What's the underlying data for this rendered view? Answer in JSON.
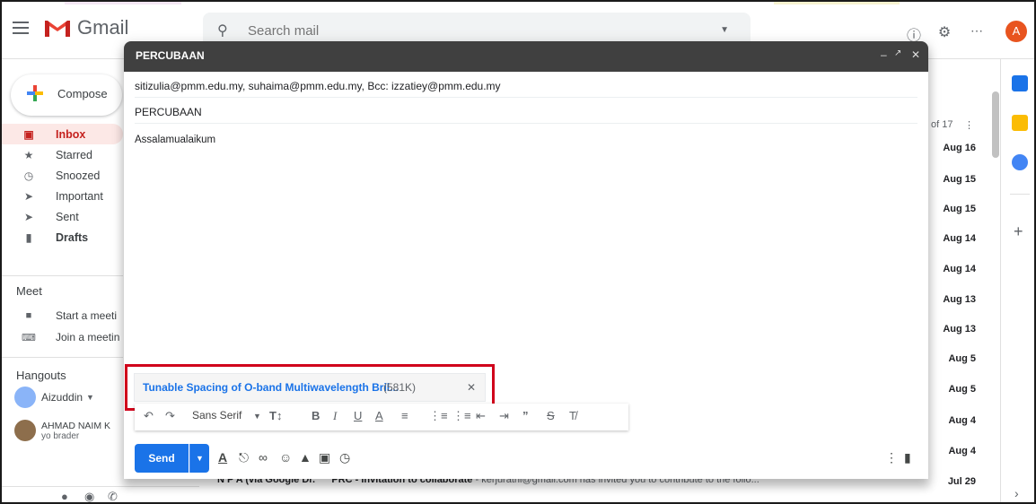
{
  "app": {
    "logo_text": "Gmail",
    "avatar_letter": "A"
  },
  "search": {
    "placeholder": "Search mail"
  },
  "sidebar": {
    "compose_label": "Compose",
    "items": [
      {
        "label": "Inbox",
        "icon": "inbox-icon"
      },
      {
        "label": "Starred",
        "icon": "star-icon"
      },
      {
        "label": "Snoozed",
        "icon": "clock-icon"
      },
      {
        "label": "Important",
        "icon": "important-icon"
      },
      {
        "label": "Sent",
        "icon": "send-icon"
      },
      {
        "label": "Drafts",
        "icon": "draft-icon"
      }
    ],
    "meet_title": "Meet",
    "meet_items": [
      "Start a meeti",
      "Join a meetin"
    ],
    "hangouts_title": "Hangouts",
    "hangouts_user": "Aizuddin",
    "hangouts_contact": "AHMAD NAIM K",
    "hangouts_contact_status": "yo brader"
  },
  "list": {
    "count": "of 17",
    "dates": [
      "Aug 16",
      "Aug 15",
      "Aug 15",
      "Aug 14",
      "Aug 14",
      "Aug 13",
      "Aug 13",
      "Aug 5",
      "Aug 5",
      "Aug 4",
      "Aug 4",
      "Jul 29"
    ],
    "behind_sender": "N P A (via Google Dr.",
    "behind_subject": "PRC - Invitation to collaborate",
    "behind_snippet": "- kerjurathi@gmail.com has invited you to contribute to the follo..."
  },
  "compose": {
    "title": "PERCUBAAN",
    "recipients": "sitizulia@pmm.edu.my, suhaima@pmm.edu.my, Bcc: izzatiey@pmm.edu.my",
    "subject": "PERCUBAAN",
    "body": "Assalamualaikum",
    "attachment_name": "Tunable Spacing of O-band Multiwavelength Bril...",
    "attachment_size": "(581K)",
    "font_name": "Sans Serif",
    "send_label": "Send"
  },
  "colors": {
    "accent": "#1a73e8",
    "highlight_box": "#d0021b",
    "inbox_active": "#c5221f"
  }
}
